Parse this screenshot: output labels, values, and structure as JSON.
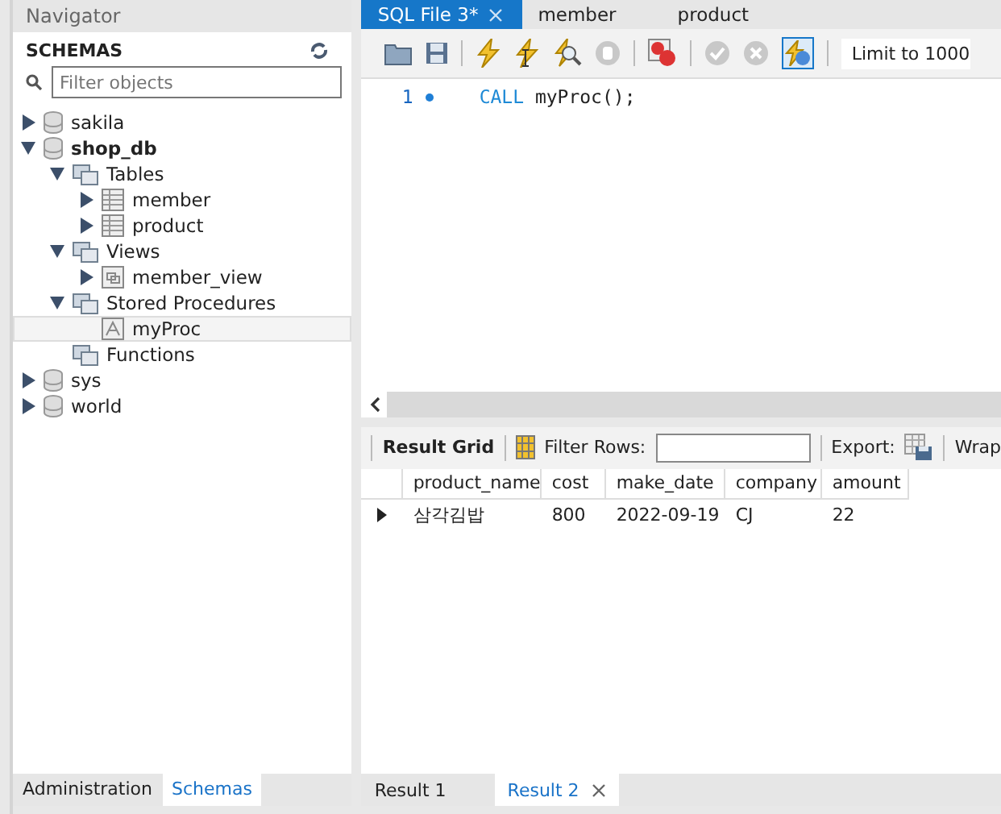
{
  "navigator": {
    "title": "Navigator",
    "section_title": "SCHEMAS",
    "filter": {
      "placeholder": "Filter objects"
    },
    "tree": [
      {
        "label": "sakila",
        "kind": "schema",
        "expandable": true,
        "expanded": false,
        "selected": false,
        "bold": false
      },
      {
        "label": "shop_db",
        "kind": "schema",
        "expandable": true,
        "expanded": true,
        "selected": false,
        "bold": true,
        "children": [
          {
            "label": "Tables",
            "kind": "folder",
            "expandable": true,
            "expanded": true,
            "selected": false,
            "bold": false,
            "children": [
              {
                "label": "member",
                "kind": "table",
                "expandable": true,
                "expanded": false,
                "selected": false,
                "bold": false
              },
              {
                "label": "product",
                "kind": "table",
                "expandable": true,
                "expanded": false,
                "selected": false,
                "bold": false
              }
            ]
          },
          {
            "label": "Views",
            "kind": "folder",
            "expandable": true,
            "expanded": true,
            "selected": false,
            "bold": false,
            "children": [
              {
                "label": "member_view",
                "kind": "view",
                "expandable": true,
                "expanded": false,
                "selected": false,
                "bold": false
              }
            ]
          },
          {
            "label": "Stored Procedures",
            "kind": "folder",
            "expandable": true,
            "expanded": true,
            "selected": false,
            "bold": false,
            "children": [
              {
                "label": "myProc",
                "kind": "procedure",
                "expandable": false,
                "expanded": false,
                "selected": true,
                "bold": false
              }
            ]
          },
          {
            "label": "Functions",
            "kind": "folder",
            "expandable": false,
            "expanded": false,
            "selected": false,
            "bold": false
          }
        ]
      },
      {
        "label": "sys",
        "kind": "schema",
        "expandable": true,
        "expanded": false,
        "selected": false,
        "bold": false
      },
      {
        "label": "world",
        "kind": "schema",
        "expandable": true,
        "expanded": false,
        "selected": false,
        "bold": false
      }
    ],
    "bottom_tabs": [
      {
        "label": "Administration",
        "selected": false
      },
      {
        "label": "Schemas",
        "selected": true
      }
    ]
  },
  "editor_tabs": [
    {
      "label": "SQL File 3*",
      "selected": true,
      "closable": true
    },
    {
      "label": "member",
      "selected": false,
      "closable": false
    },
    {
      "label": "product",
      "selected": false,
      "closable": false
    }
  ],
  "toolbar": {
    "limit": "Limit to 1000",
    "toggle_on": true
  },
  "editor": {
    "lines": [
      {
        "number": "1",
        "keyword": "CALL",
        "rest": "myProc();"
      }
    ]
  },
  "result_toolbar": {
    "grid_label": "Result Grid",
    "filter_label": "Filter Rows:",
    "export_label": "Export:",
    "wrap_label": "Wrap"
  },
  "table": {
    "columns": [
      "product_name",
      "cost",
      "make_date",
      "company",
      "amount"
    ],
    "rows": [
      [
        "삼각김밥",
        "800",
        "2022-09-19",
        "CJ",
        "22"
      ]
    ]
  },
  "result_tabs": [
    {
      "label": "Result 1",
      "selected": false,
      "closable": false
    },
    {
      "label": "Result 2",
      "selected": true,
      "closable": true
    }
  ]
}
